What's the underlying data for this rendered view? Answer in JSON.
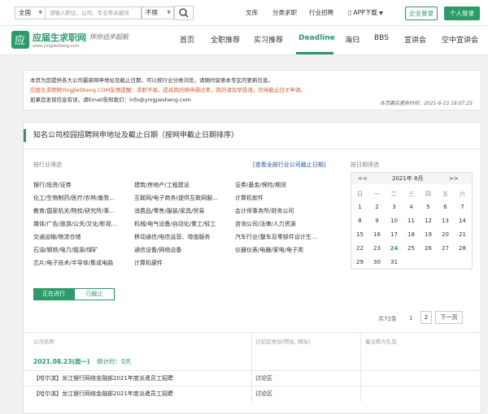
{
  "topbar": {
    "region_select": "全国",
    "search_placeholder": "请输入职位、公司、专业等关键词",
    "type_select": "不限",
    "links": [
      "文库",
      "分类求职",
      "行业招聘",
      "APP下载"
    ],
    "company_login": "企业登录",
    "personal_login": "个人登录"
  },
  "header": {
    "logo_title": "应届生求职网",
    "logo_slogan": "伴你远步起航",
    "logo_url": "www.yingjiesheng.com",
    "nav": [
      "首页",
      "全职推荐",
      "实习推荐",
      "Deadline",
      "海归",
      "BBS",
      "宣讲会",
      "空中宣讲会"
    ]
  },
  "notice": {
    "line1": "本页为您提供各大公司最新网申地址及截止日期，可以按行业分类浏览，请随时留意本专区的更新信息。",
    "line2": "应届生求职网YingJieSheng.COM友情提醒：求职不易，提高简历网申通过率，简历请及早投递，勿待截止日才申请。",
    "line3": "如果您发现信息有误，请Email告知我们：info@yingjiesheng.com",
    "updated": "本页最后更新时间：2021-8-23 18:07:25"
  },
  "panel": {
    "title": "知名公司校园招聘网申地址及截止日期（按网申截止日期排序）",
    "industry_label": "按行业筛选",
    "view_all": "[查看全部行业公司截止日期]",
    "date_label": "按日期筛选",
    "categories": [
      [
        "银行/投资/证券",
        "建筑/房地产/工程建设",
        "证券/基金/保险/期货"
      ],
      [
        "化工/生物制药/医疗/农林/畜牧...",
        "互联网/电子商务(提供互联网服...",
        "计算机软件"
      ],
      [
        "教育/国家机关/院校/研究所/事...",
        "消费品/零售/服装/家具/贸易",
        "会计师事务所/财务公司"
      ],
      [
        "媒体/广告/旅游/公关/文化/影视...",
        "机械/电气设备/自动化/重工/轻工",
        "咨询公司/法律/人力资源"
      ],
      [
        "交通运输/物流仓储",
        "移动通信/电信运营、增值服务",
        "汽车行业(整车及零部件设计生..."
      ],
      [
        "石油/钢铁/电力/能源/煤矿",
        "通信设备/网络设备",
        "仪器仪表/电器/家电/电子类"
      ],
      [
        "芯片/电子技术/半导体/集成电路",
        "计算机硬件",
        ""
      ]
    ],
    "calendar": {
      "prev": "<<",
      "month": "2021年 8月",
      "next": ">>",
      "weekdays": [
        "日",
        "一",
        "二",
        "三",
        "四",
        "五",
        "六"
      ],
      "weeks": [
        [
          "1",
          "2",
          "3",
          "4",
          "5",
          "6",
          "7"
        ],
        [
          "8",
          "9",
          "10",
          "11",
          "12",
          "13",
          "14"
        ],
        [
          "15",
          "16",
          "17",
          "18",
          "19",
          "20",
          "21"
        ],
        [
          "22",
          "23",
          "24",
          "25",
          "26",
          "27",
          "28"
        ],
        [
          "29",
          "30",
          "31",
          "",
          "",
          "",
          ""
        ]
      ],
      "today": "24"
    },
    "tabs": [
      "正在进行",
      "已截止"
    ],
    "pager": {
      "total": "共72条",
      "page1": "1",
      "page2": "2",
      "next": "下一页"
    },
    "columns": [
      "公司名称",
      "讨论区地址(吧址, 网址)",
      "备注和大礼包"
    ],
    "date_row": {
      "date": "2021.08.23(周一)",
      "countdown": "倒计时：0天"
    },
    "rows": [
      {
        "company": "【哈尔滨】龙江银行网络金融部2021年度派遣员工招聘",
        "forum": "讨论区"
      },
      {
        "company": "【哈尔滨】龙江银行网络金融部2021年度派遣员工招聘",
        "forum": "讨论区"
      }
    ]
  },
  "colors": {
    "brand": "#2b9b67",
    "accent": "#e05a2b",
    "link": "#1f5fb0"
  }
}
